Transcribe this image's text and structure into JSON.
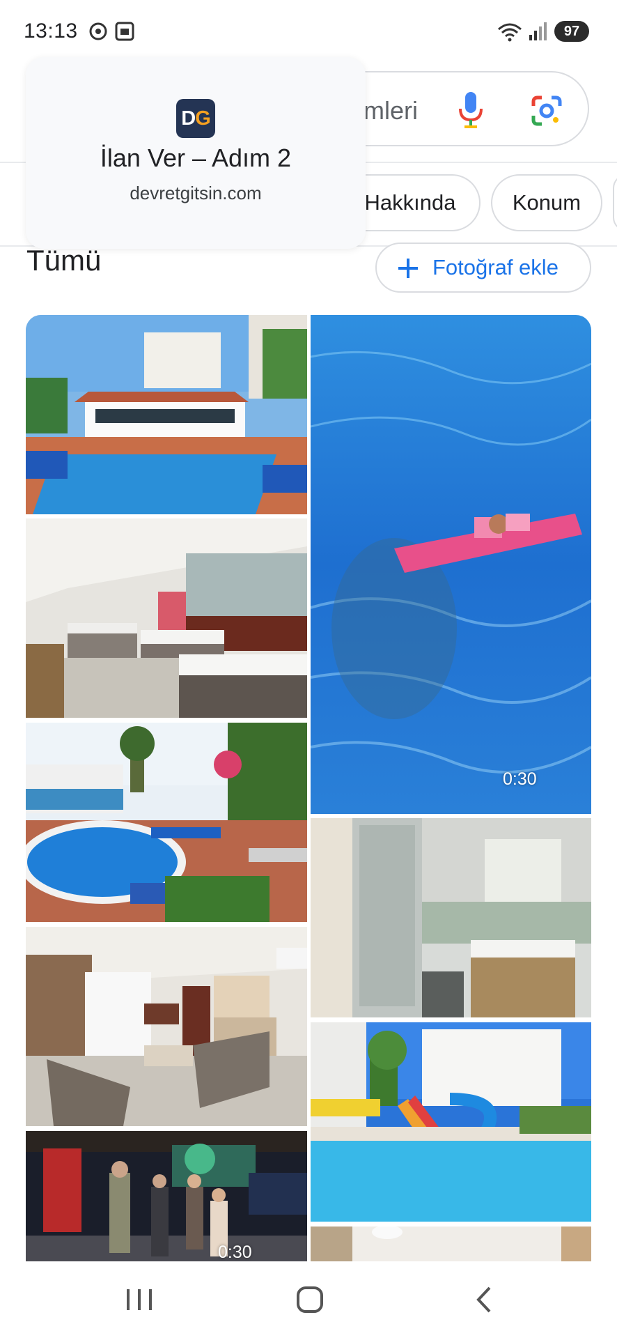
{
  "status_bar": {
    "time": "13:13",
    "battery": "97",
    "icons": [
      "notification-icon",
      "screenshot-icon",
      "wifi-icon",
      "signal-icon",
      "battery-icon"
    ]
  },
  "search": {
    "partial_text": "mleri"
  },
  "chips": [
    {
      "label": "Hakkında"
    },
    {
      "label": "Konum"
    }
  ],
  "section": {
    "title": "Tümü",
    "add_photo_label": "Fotoğraf ekle"
  },
  "photos": [
    {
      "alt": "hotel-exterior-pool"
    },
    {
      "alt": "pool-video",
      "duration": "0:30"
    },
    {
      "alt": "hotel-bedroom"
    },
    {
      "alt": "pool-garden"
    },
    {
      "alt": "bathroom"
    },
    {
      "alt": "living-room"
    },
    {
      "alt": "waterslide-pool"
    },
    {
      "alt": "night-entertainment-video",
      "duration": "0:30"
    }
  ],
  "popup": {
    "logo_d": "D",
    "logo_g": "G",
    "title": "İlan Ver – Adım 2",
    "url": "devretgitsin.com"
  },
  "colors": {
    "accent": "#1a73e8",
    "logo_bg": "#243454",
    "logo_orange": "#f5a020"
  }
}
